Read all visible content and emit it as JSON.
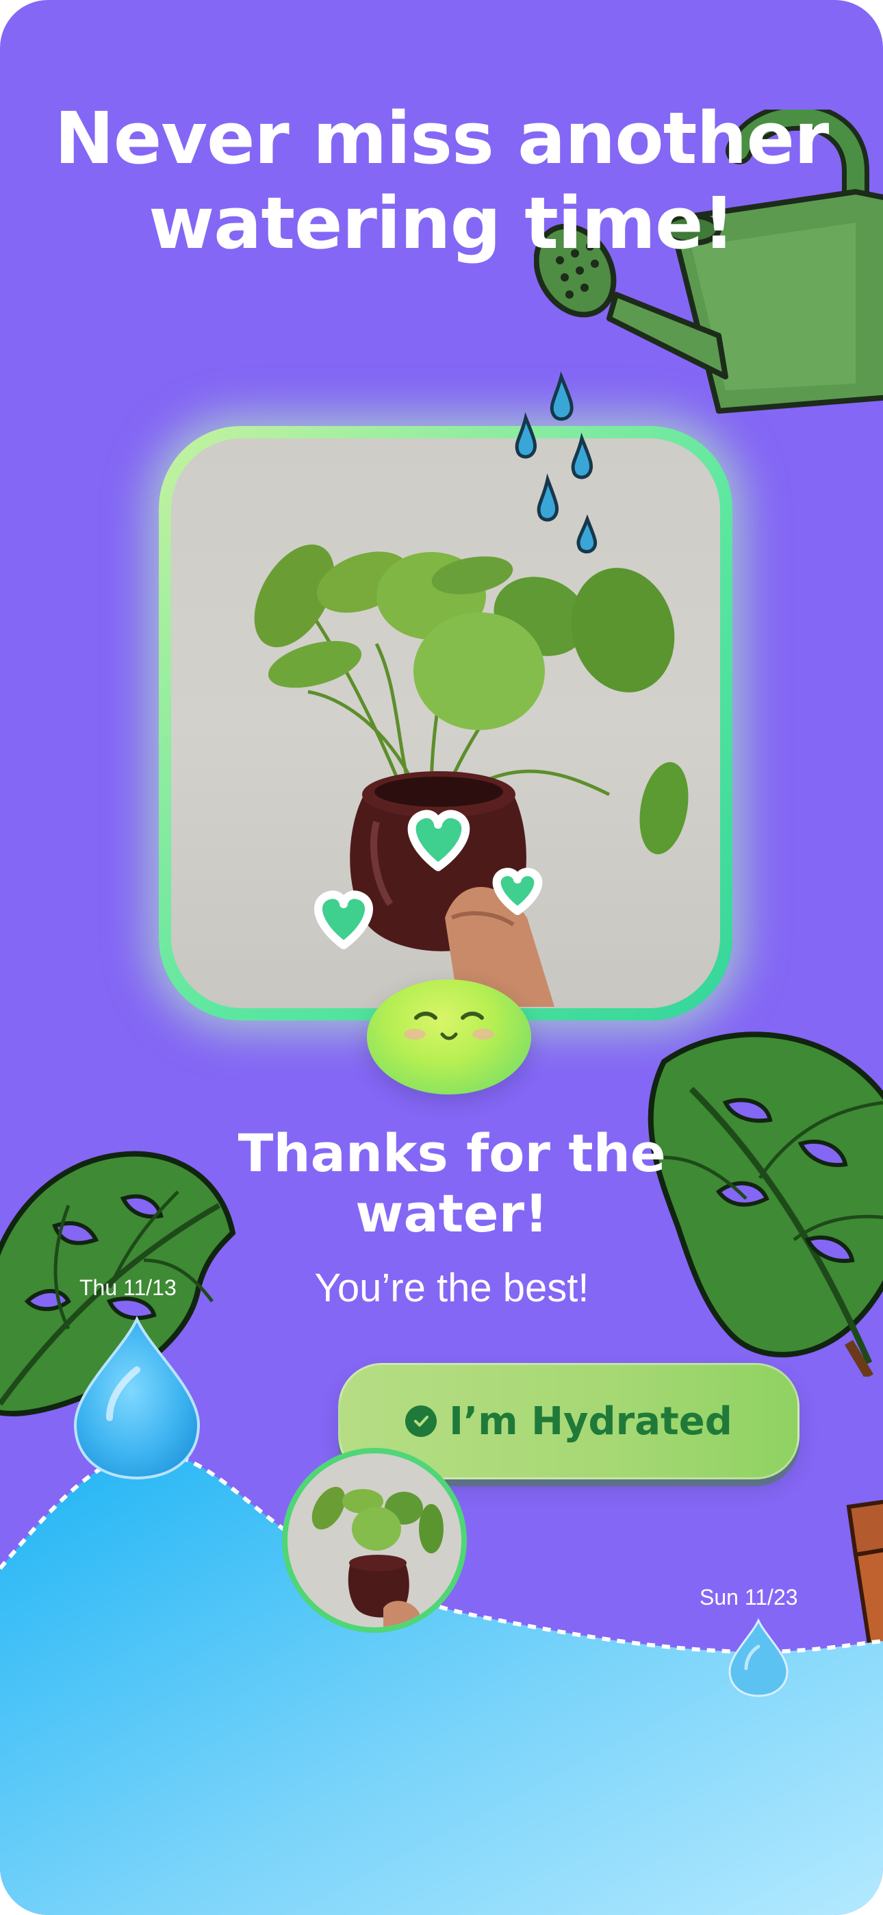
{
  "headline": {
    "line1": "Never miss another",
    "line2": "watering time!"
  },
  "plant_photo": {
    "icon": "pilea-plant-photo"
  },
  "mascot": {
    "icon": "smiling-blob-mascot"
  },
  "message": {
    "title_line1": "Thanks for the",
    "title_line2": "water!",
    "subtitle": "You’re the best!"
  },
  "action": {
    "hydrated_label": "I’m Hydrated",
    "icon": "checkmark-circle-icon"
  },
  "timeline": {
    "start_date": "Thu 11/13",
    "end_date": "Sun 11/23"
  },
  "colors": {
    "background": "#8467F5",
    "accent_green": "#1f7a39",
    "button_green": "#a6d874",
    "water_blue": "#2fb6f5"
  }
}
